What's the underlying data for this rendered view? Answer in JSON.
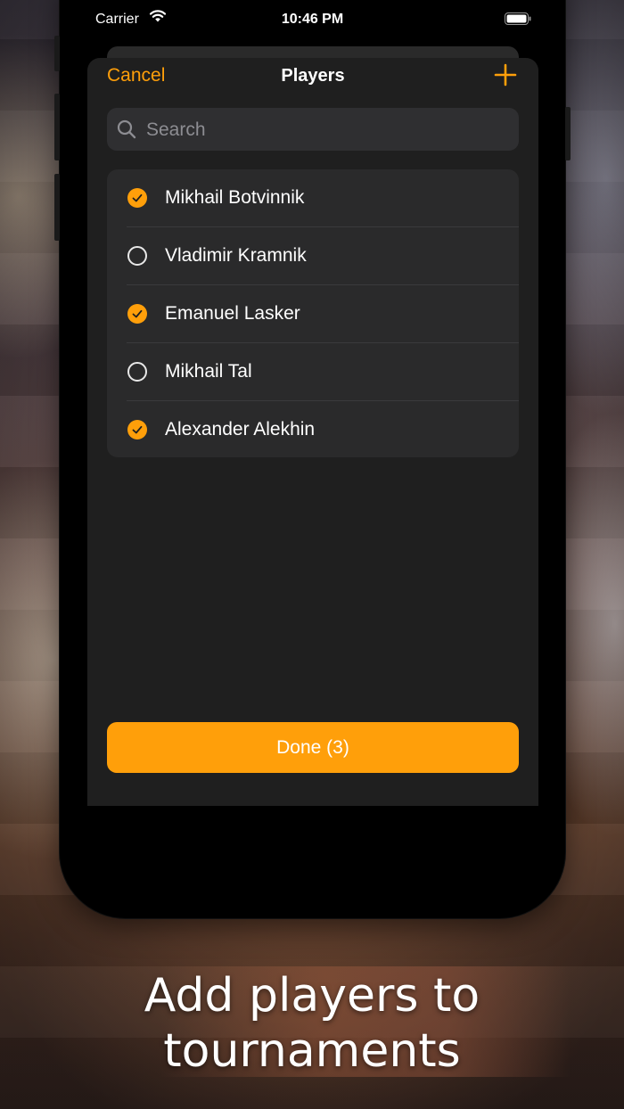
{
  "status_bar": {
    "carrier": "Carrier",
    "time": "10:46 PM"
  },
  "nav": {
    "cancel_label": "Cancel",
    "title": "Players",
    "add_icon": "plus-icon"
  },
  "search": {
    "placeholder": "Search",
    "value": ""
  },
  "players": [
    {
      "name": "Mikhail Botvinnik",
      "selected": true
    },
    {
      "name": "Vladimir Kramnik",
      "selected": false
    },
    {
      "name": "Emanuel Lasker",
      "selected": true
    },
    {
      "name": "Mikhail Tal",
      "selected": false
    },
    {
      "name": "Alexander Alekhin",
      "selected": true
    }
  ],
  "done_label": "Done (3)",
  "caption": {
    "line1": "Add players to",
    "line2": "tournaments"
  },
  "colors": {
    "accent": "#ff9f0a",
    "sheet_background": "#1f1f1f",
    "list_background": "#2a2a2b"
  }
}
